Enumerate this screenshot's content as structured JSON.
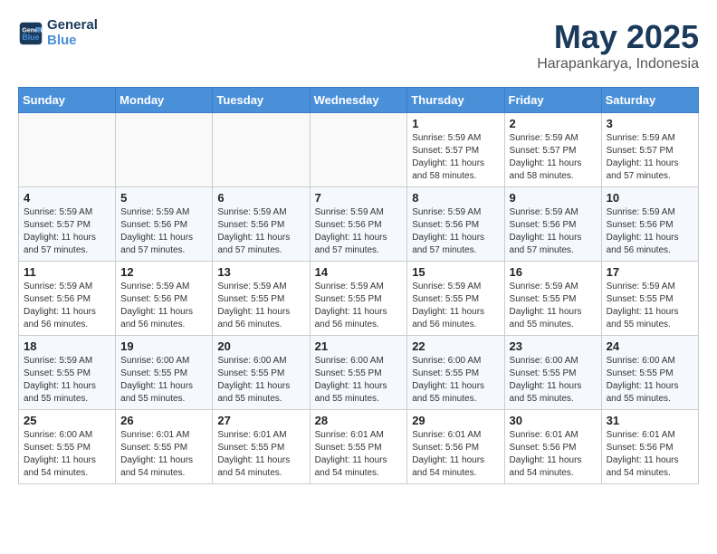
{
  "header": {
    "logo_line1": "General",
    "logo_line2": "Blue",
    "title": "May 2025",
    "subtitle": "Harapankarya, Indonesia"
  },
  "days_of_week": [
    "Sunday",
    "Monday",
    "Tuesday",
    "Wednesday",
    "Thursday",
    "Friday",
    "Saturday"
  ],
  "weeks": [
    [
      {
        "day": "",
        "info": ""
      },
      {
        "day": "",
        "info": ""
      },
      {
        "day": "",
        "info": ""
      },
      {
        "day": "",
        "info": ""
      },
      {
        "day": "1",
        "info": "Sunrise: 5:59 AM\nSunset: 5:57 PM\nDaylight: 11 hours\nand 58 minutes."
      },
      {
        "day": "2",
        "info": "Sunrise: 5:59 AM\nSunset: 5:57 PM\nDaylight: 11 hours\nand 58 minutes."
      },
      {
        "day": "3",
        "info": "Sunrise: 5:59 AM\nSunset: 5:57 PM\nDaylight: 11 hours\nand 57 minutes."
      }
    ],
    [
      {
        "day": "4",
        "info": "Sunrise: 5:59 AM\nSunset: 5:57 PM\nDaylight: 11 hours\nand 57 minutes."
      },
      {
        "day": "5",
        "info": "Sunrise: 5:59 AM\nSunset: 5:56 PM\nDaylight: 11 hours\nand 57 minutes."
      },
      {
        "day": "6",
        "info": "Sunrise: 5:59 AM\nSunset: 5:56 PM\nDaylight: 11 hours\nand 57 minutes."
      },
      {
        "day": "7",
        "info": "Sunrise: 5:59 AM\nSunset: 5:56 PM\nDaylight: 11 hours\nand 57 minutes."
      },
      {
        "day": "8",
        "info": "Sunrise: 5:59 AM\nSunset: 5:56 PM\nDaylight: 11 hours\nand 57 minutes."
      },
      {
        "day": "9",
        "info": "Sunrise: 5:59 AM\nSunset: 5:56 PM\nDaylight: 11 hours\nand 57 minutes."
      },
      {
        "day": "10",
        "info": "Sunrise: 5:59 AM\nSunset: 5:56 PM\nDaylight: 11 hours\nand 56 minutes."
      }
    ],
    [
      {
        "day": "11",
        "info": "Sunrise: 5:59 AM\nSunset: 5:56 PM\nDaylight: 11 hours\nand 56 minutes."
      },
      {
        "day": "12",
        "info": "Sunrise: 5:59 AM\nSunset: 5:56 PM\nDaylight: 11 hours\nand 56 minutes."
      },
      {
        "day": "13",
        "info": "Sunrise: 5:59 AM\nSunset: 5:55 PM\nDaylight: 11 hours\nand 56 minutes."
      },
      {
        "day": "14",
        "info": "Sunrise: 5:59 AM\nSunset: 5:55 PM\nDaylight: 11 hours\nand 56 minutes."
      },
      {
        "day": "15",
        "info": "Sunrise: 5:59 AM\nSunset: 5:55 PM\nDaylight: 11 hours\nand 56 minutes."
      },
      {
        "day": "16",
        "info": "Sunrise: 5:59 AM\nSunset: 5:55 PM\nDaylight: 11 hours\nand 55 minutes."
      },
      {
        "day": "17",
        "info": "Sunrise: 5:59 AM\nSunset: 5:55 PM\nDaylight: 11 hours\nand 55 minutes."
      }
    ],
    [
      {
        "day": "18",
        "info": "Sunrise: 5:59 AM\nSunset: 5:55 PM\nDaylight: 11 hours\nand 55 minutes."
      },
      {
        "day": "19",
        "info": "Sunrise: 6:00 AM\nSunset: 5:55 PM\nDaylight: 11 hours\nand 55 minutes."
      },
      {
        "day": "20",
        "info": "Sunrise: 6:00 AM\nSunset: 5:55 PM\nDaylight: 11 hours\nand 55 minutes."
      },
      {
        "day": "21",
        "info": "Sunrise: 6:00 AM\nSunset: 5:55 PM\nDaylight: 11 hours\nand 55 minutes."
      },
      {
        "day": "22",
        "info": "Sunrise: 6:00 AM\nSunset: 5:55 PM\nDaylight: 11 hours\nand 55 minutes."
      },
      {
        "day": "23",
        "info": "Sunrise: 6:00 AM\nSunset: 5:55 PM\nDaylight: 11 hours\nand 55 minutes."
      },
      {
        "day": "24",
        "info": "Sunrise: 6:00 AM\nSunset: 5:55 PM\nDaylight: 11 hours\nand 55 minutes."
      }
    ],
    [
      {
        "day": "25",
        "info": "Sunrise: 6:00 AM\nSunset: 5:55 PM\nDaylight: 11 hours\nand 54 minutes."
      },
      {
        "day": "26",
        "info": "Sunrise: 6:01 AM\nSunset: 5:55 PM\nDaylight: 11 hours\nand 54 minutes."
      },
      {
        "day": "27",
        "info": "Sunrise: 6:01 AM\nSunset: 5:55 PM\nDaylight: 11 hours\nand 54 minutes."
      },
      {
        "day": "28",
        "info": "Sunrise: 6:01 AM\nSunset: 5:55 PM\nDaylight: 11 hours\nand 54 minutes."
      },
      {
        "day": "29",
        "info": "Sunrise: 6:01 AM\nSunset: 5:56 PM\nDaylight: 11 hours\nand 54 minutes."
      },
      {
        "day": "30",
        "info": "Sunrise: 6:01 AM\nSunset: 5:56 PM\nDaylight: 11 hours\nand 54 minutes."
      },
      {
        "day": "31",
        "info": "Sunrise: 6:01 AM\nSunset: 5:56 PM\nDaylight: 11 hours\nand 54 minutes."
      }
    ]
  ]
}
